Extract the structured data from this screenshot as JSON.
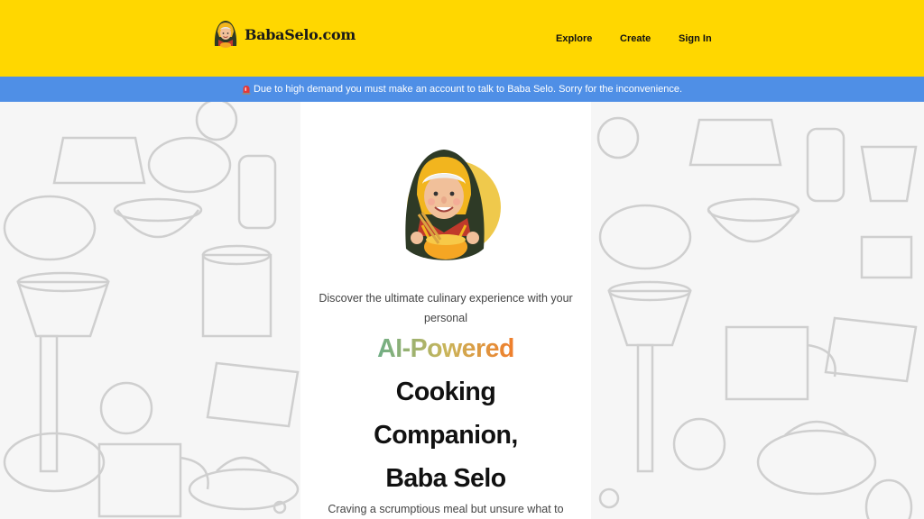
{
  "header": {
    "brand": "BabaSelo.com",
    "nav": {
      "explore": "Explore",
      "create": "Create",
      "sign_in": "Sign In"
    }
  },
  "banner": {
    "icon": "siren-icon",
    "text": "Due to high demand you must make an account to talk to Baba Selo. Sorry for the inconvenience."
  },
  "hero": {
    "intro": "Discover the ultimate culinary experience with your personal",
    "highlight": "AI-Powered",
    "line2": "Cooking",
    "line3": "Companion,",
    "line4": "Baba Selo",
    "description": "Craving a scrumptious meal but unsure what to"
  },
  "colors": {
    "header_bg": "#ffd700",
    "banner_bg": "#4f8fe6",
    "gradient": [
      "#6fae86",
      "#c9b55a",
      "#f07d2a"
    ]
  }
}
